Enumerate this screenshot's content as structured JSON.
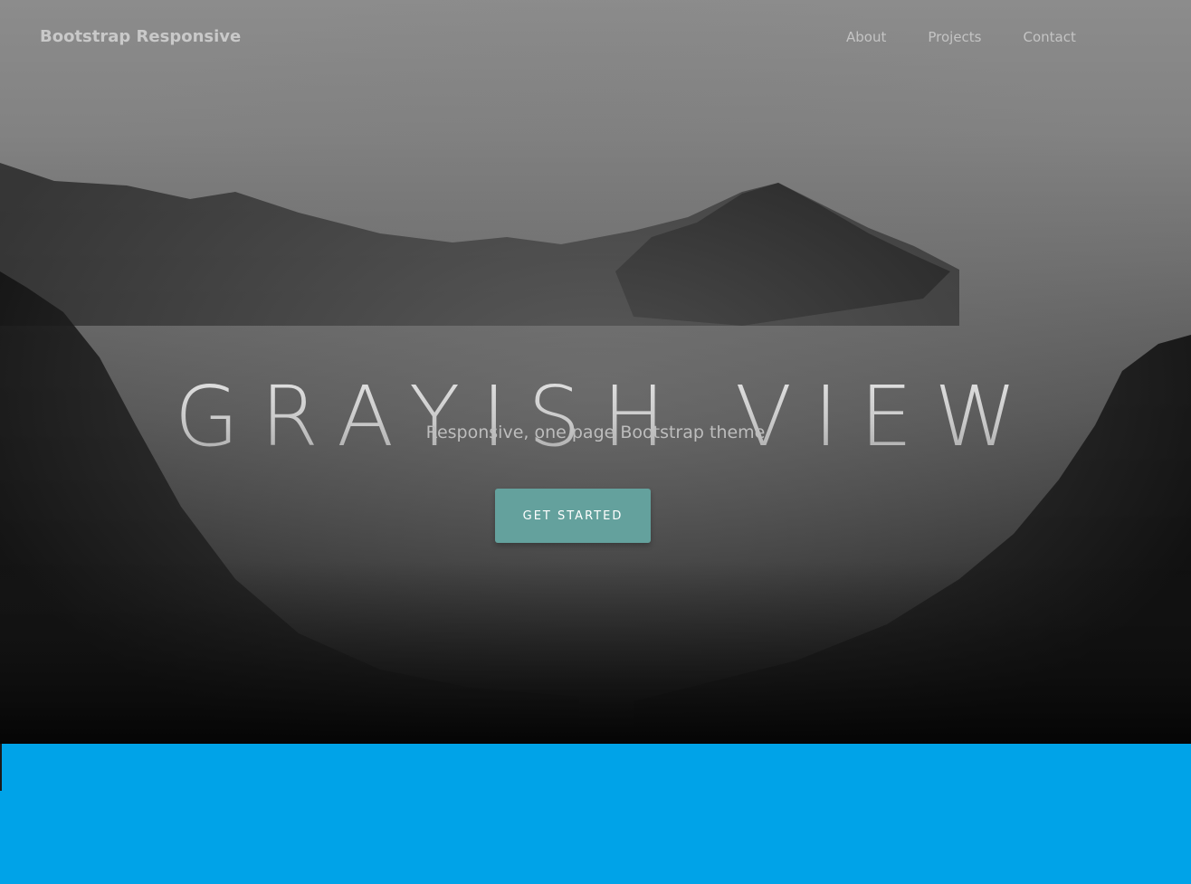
{
  "navbar": {
    "brand": "Bootstrap Responsive",
    "links": [
      {
        "label": "About"
      },
      {
        "label": "Projects"
      },
      {
        "label": "Contact"
      }
    ]
  },
  "hero": {
    "title": "GRAYISH VIEW",
    "subtitle": "Responsive, one page Bootstrap theme",
    "cta_label": "GET STARTED"
  },
  "colors": {
    "cta_background": "#64a19d",
    "section_background": "#00a3e8"
  }
}
